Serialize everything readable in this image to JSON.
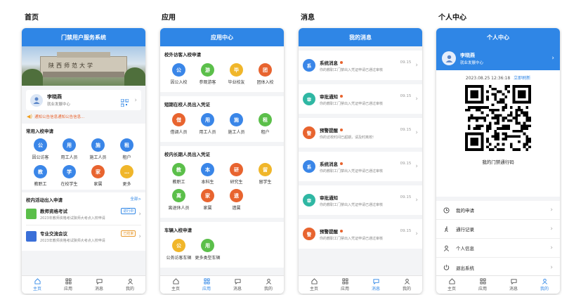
{
  "screens": {
    "home": {
      "label": "首页",
      "title": "门禁用户服务系统",
      "banner_text": "陕西师范大学",
      "user": {
        "name": "李晓燕",
        "org": "就业发展中心"
      },
      "notice": "通知公告信息通知公告信息...",
      "common_title": "常用入校申请",
      "common_items": [
        {
          "icon": "公",
          "label": "因公访客",
          "color": "#3a86e8"
        },
        {
          "icon": "用",
          "label": "用工人员",
          "color": "#3a86e8"
        },
        {
          "icon": "施",
          "label": "施工人员",
          "color": "#3a86e8"
        },
        {
          "icon": "租",
          "label": "租户",
          "color": "#3a86e8"
        },
        {
          "icon": "教",
          "label": "教职工",
          "color": "#3a86e8"
        },
        {
          "icon": "学",
          "label": "在校学生",
          "color": "#3a86e8"
        },
        {
          "icon": "家",
          "label": "家属",
          "color": "#e8642f"
        },
        {
          "icon": "…",
          "label": "更多",
          "color": "#f0b62a"
        }
      ],
      "activity_title": "校内活动出入申请",
      "activity_all": "全部>",
      "activities": [
        {
          "title": "教师资格考试",
          "desc": "2023年教师资格考试陕师大考点入校申请",
          "status": "进行中",
          "status_color": "#2f86e6",
          "icon_color": "#5bbf4a"
        },
        {
          "title": "专业交流会议",
          "desc": "2023年教师资格考试陕师大考点入校申请",
          "status": "已结束",
          "status_color": "#e89a2f",
          "icon_color": "#3a6fd8"
        }
      ]
    },
    "apps": {
      "label": "应用",
      "title": "应用中心",
      "sections": [
        {
          "title": "校外访客入校申请",
          "items": [
            {
              "icon": "公",
              "label": "因公入校",
              "color": "#3a86e8"
            },
            {
              "icon": "游",
              "label": "参观游客",
              "color": "#5bbf4a"
            },
            {
              "icon": "毕",
              "label": "毕业校友",
              "color": "#f0b62a"
            },
            {
              "icon": "团",
              "label": "团体入校",
              "color": "#e8642f"
            }
          ]
        },
        {
          "title": "短期在校人员出入凭证",
          "items": [
            {
              "icon": "借",
              "label": "借调人员",
              "color": "#e8642f"
            },
            {
              "icon": "用",
              "label": "用工人员",
              "color": "#3a86e8"
            },
            {
              "icon": "施",
              "label": "施工人员",
              "color": "#3a86e8"
            },
            {
              "icon": "租",
              "label": "租户",
              "color": "#5bbf4a"
            }
          ]
        },
        {
          "title": "校内长期人员出入凭证",
          "items": [
            {
              "icon": "教",
              "label": "教职工",
              "color": "#5bbf4a"
            },
            {
              "icon": "本",
              "label": "本科生",
              "color": "#3a86e8"
            },
            {
              "icon": "研",
              "label": "研究生",
              "color": "#e8642f"
            },
            {
              "icon": "留",
              "label": "留学生",
              "color": "#f0b62a"
            },
            {
              "icon": "离",
              "label": "离退休人员",
              "color": "#5bbf4a"
            },
            {
              "icon": "家",
              "label": "家属",
              "color": "#e8642f"
            },
            {
              "icon": "遗",
              "label": "遗属",
              "color": "#e8642f"
            }
          ]
        },
        {
          "title": "车辆入校申请",
          "items": [
            {
              "icon": "公",
              "label": "公务访客车辆",
              "color": "#f0b62a"
            },
            {
              "icon": "用",
              "label": "更多类型车辆",
              "color": "#5bbf4a"
            }
          ]
        }
      ]
    },
    "messages": {
      "label": "消息",
      "title": "我的消息",
      "items": [
        {
          "icon": "系",
          "color": "#3a86e8",
          "title": "系统消息",
          "time": "09.15",
          "desc": "你的教职工门禁出入凭证申请已通过审核",
          "unread": true
        },
        {
          "icon": "审",
          "color": "#2fb7a3",
          "title": "审批通知",
          "time": "09.15",
          "desc": "你的教职工门禁出入凭证申请已通过审核",
          "unread": true
        },
        {
          "icon": "警",
          "color": "#e8642f",
          "title": "预警提醒",
          "time": "09.15",
          "desc": "你的访校时间已超期，请及时离校!",
          "unread": true
        },
        {
          "icon": "系",
          "color": "#3a86e8",
          "title": "系统消息",
          "time": "09.15",
          "desc": "你的教职工门禁出入凭证申请已通过审核",
          "unread": true
        },
        {
          "icon": "审",
          "color": "#2fb7a3",
          "title": "审批通知",
          "time": "09.15",
          "desc": "你的教职工门禁出入凭证申请已通过审核",
          "unread": false
        },
        {
          "icon": "警",
          "color": "#e8642f",
          "title": "预警提醒",
          "time": "09.15",
          "desc": "你的教职工门禁出入凭证申请已通过审核",
          "unread": true
        }
      ]
    },
    "profile": {
      "label": "个人中心",
      "title": "个人中心",
      "user": {
        "name": "李晓燕",
        "org": "就业发展中心"
      },
      "timestamp": "2023.08.25 12:36:18",
      "refresh": "立即刷新",
      "qr_caption": "我的门禁通行码",
      "menu": [
        {
          "icon": "clock-icon",
          "label": "我的申请"
        },
        {
          "icon": "walk-icon",
          "label": "通行记录"
        },
        {
          "icon": "person-icon",
          "label": "个人信息"
        },
        {
          "icon": "power-icon",
          "label": "退出系统"
        }
      ]
    }
  },
  "tabbar": [
    "主页",
    "应用",
    "消息",
    "我的"
  ],
  "colors": {
    "brand": "#2f86e6"
  }
}
